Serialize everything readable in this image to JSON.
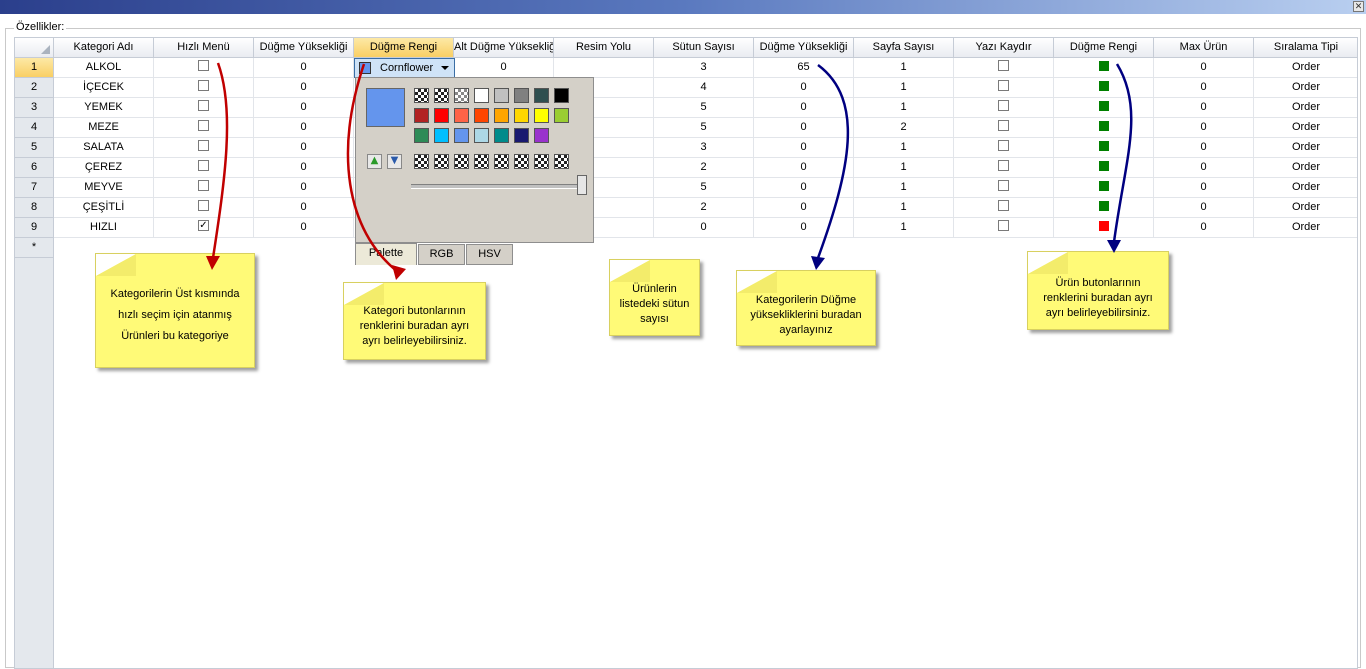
{
  "window": {
    "close_glyph": "✕"
  },
  "group": {
    "label": "Özellikler:"
  },
  "columns": [
    "Kategori Adı",
    "Hızlı Menü",
    "Düğme Yüksekliği",
    "Düğme Rengi",
    "Alt Düğme Yüksekliği",
    "Resim Yolu",
    "Sütun Sayısı",
    "Düğme Yüksekliği",
    "Sayfa Sayısı",
    "Yazı Kaydır",
    "Düğme Rengi",
    "Max Ürün",
    "Sıralama Tipi"
  ],
  "rows": [
    {
      "num": "1",
      "name": "ALKOL",
      "quick": false,
      "btn_h": "0",
      "color": "#6495ed",
      "sub_h": "0",
      "img": "",
      "cols": "3",
      "prod_h": "65",
      "pages": "1",
      "wrap": false,
      "prod_color": "#008000",
      "max": "0",
      "sort": "Order"
    },
    {
      "num": "2",
      "name": "İÇECEK",
      "quick": false,
      "btn_h": "0",
      "color": "",
      "sub_h": "",
      "img": "",
      "cols": "4",
      "prod_h": "0",
      "pages": "1",
      "wrap": false,
      "prod_color": "#008000",
      "max": "0",
      "sort": "Order"
    },
    {
      "num": "3",
      "name": "YEMEK",
      "quick": false,
      "btn_h": "0",
      "color": "",
      "sub_h": "",
      "img": "",
      "cols": "5",
      "prod_h": "0",
      "pages": "1",
      "wrap": false,
      "prod_color": "#008000",
      "max": "0",
      "sort": "Order"
    },
    {
      "num": "4",
      "name": "MEZE",
      "quick": false,
      "btn_h": "0",
      "color": "",
      "sub_h": "",
      "img": "",
      "cols": "5",
      "prod_h": "0",
      "pages": "2",
      "wrap": false,
      "prod_color": "#008000",
      "max": "0",
      "sort": "Order"
    },
    {
      "num": "5",
      "name": "SALATA",
      "quick": false,
      "btn_h": "0",
      "color": "",
      "sub_h": "",
      "img": "",
      "cols": "3",
      "prod_h": "0",
      "pages": "1",
      "wrap": false,
      "prod_color": "#008000",
      "max": "0",
      "sort": "Order"
    },
    {
      "num": "6",
      "name": "ÇEREZ",
      "quick": false,
      "btn_h": "0",
      "color": "",
      "sub_h": "",
      "img": "",
      "cols": "2",
      "prod_h": "0",
      "pages": "1",
      "wrap": false,
      "prod_color": "#008000",
      "max": "0",
      "sort": "Order"
    },
    {
      "num": "7",
      "name": "MEYVE",
      "quick": false,
      "btn_h": "0",
      "color": "",
      "sub_h": "",
      "img": "",
      "cols": "5",
      "prod_h": "0",
      "pages": "1",
      "wrap": false,
      "prod_color": "#008000",
      "max": "0",
      "sort": "Order"
    },
    {
      "num": "8",
      "name": "ÇEŞİTLİ",
      "quick": false,
      "btn_h": "0",
      "color": "",
      "sub_h": "",
      "img": "",
      "cols": "2",
      "prod_h": "0",
      "pages": "1",
      "wrap": false,
      "prod_color": "#008000",
      "max": "0",
      "sort": "Order"
    },
    {
      "num": "9",
      "name": "HIZLI",
      "quick": true,
      "btn_h": "0",
      "color": "",
      "sub_h": "",
      "img": "",
      "cols": "0",
      "prod_h": "0",
      "pages": "1",
      "wrap": false,
      "prod_color": "#ff0000",
      "max": "0",
      "sort": "Order"
    }
  ],
  "new_row_marker": "*",
  "check_glyph": "✓",
  "color_combo": {
    "value": "Cornflower",
    "color": "#6495ed"
  },
  "color_picker": {
    "preview_color": "#6495ed",
    "row1": [
      "checker",
      "checker-dark",
      "checker-light",
      "#ffffff",
      "#c0c0c0",
      "#808080",
      "#2f4f4f",
      "#000000"
    ],
    "row2": [
      "#b22222",
      "#ff0000",
      "#ff6347",
      "#ff4500",
      "#ffa500",
      "#ffd700",
      "#ffff00",
      "#9acd32"
    ],
    "row3": [
      "#2e8b57",
      "#00bfff",
      "#6495ed",
      "#add8e6",
      "#008b8b",
      "#191970",
      "#9932cc"
    ],
    "custom_count": 8,
    "up_glyph": "▲",
    "down_glyph": "▼",
    "tabs": [
      "Palette",
      "RGB",
      "HSV"
    ],
    "active_tab": 0
  },
  "notes": {
    "quick_menu": "Kategorilerin Üst kısmında hızlı seçim için atanmış Ürünleri bu kategoriye",
    "category_color": "Kategori butonlarının renklerini buradan ayrı ayrı belirleyebilirsiniz.",
    "column_count": "Ürünlerin listedeki sütun sayısı",
    "button_height": "Kategorilerin Düğme yüksekliklerini buradan ayarlayınız",
    "product_color": "Ürün butonlarının renklerini buradan ayrı ayrı belirleyebilirsiniz."
  },
  "colors": {
    "header_active": "#f9cf64",
    "grid_line": "#c6ccd6",
    "note_bg": "#fffa77",
    "arrow_red": "#c00000",
    "arrow_blue": "#000080"
  }
}
